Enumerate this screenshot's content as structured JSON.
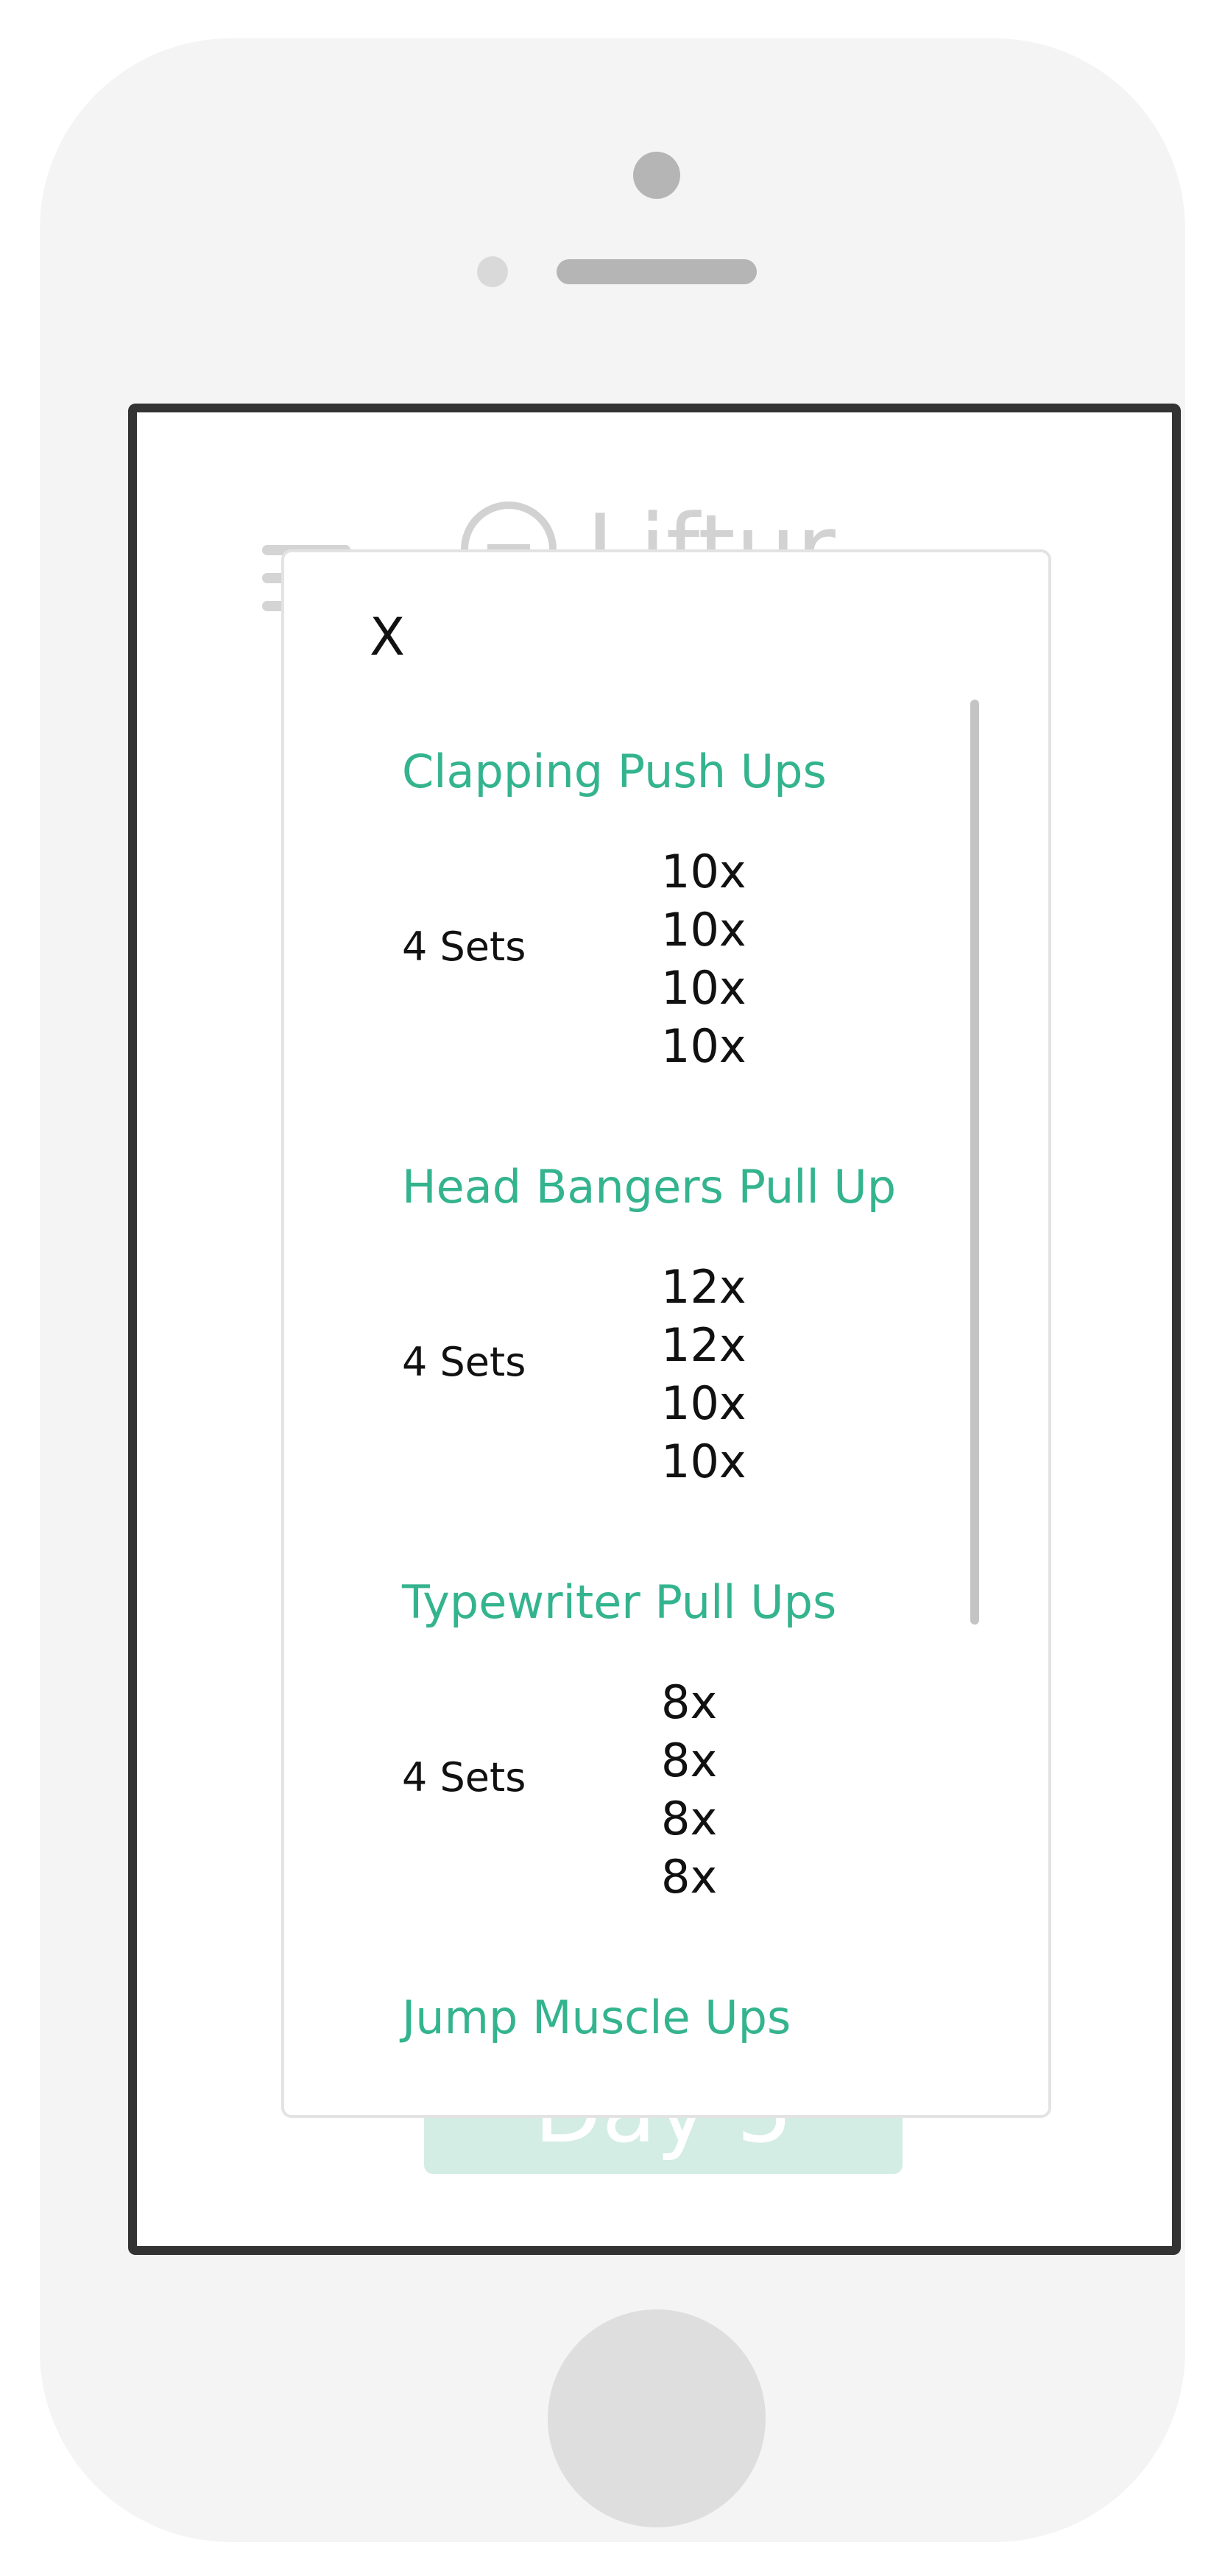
{
  "app": {
    "name": "Liftur",
    "background_button_label": "Day 5"
  },
  "modal": {
    "close_label": "X",
    "exercises": [
      {
        "name": "Clapping Push Ups",
        "sets_label": "4 Sets",
        "reps": [
          "10x",
          "10x",
          "10x",
          "10x"
        ]
      },
      {
        "name": "Head Bangers Pull Up",
        "sets_label": "4 Sets",
        "reps": [
          "12x",
          "12x",
          "10x",
          "10x"
        ]
      },
      {
        "name": "Typewriter Pull Ups",
        "sets_label": "4 Sets",
        "reps": [
          "8x",
          "8x",
          "8x",
          "8x"
        ]
      },
      {
        "name": "Jump Muscle Ups"
      }
    ]
  },
  "colors": {
    "accent": "#34b48e",
    "accent_light": "#d3ede4",
    "device_body": "#f4f4f4",
    "screen_border": "#333333"
  },
  "icons": {
    "menu": "hamburger-menu-icon",
    "logo": "dumbbell-logo-icon"
  }
}
